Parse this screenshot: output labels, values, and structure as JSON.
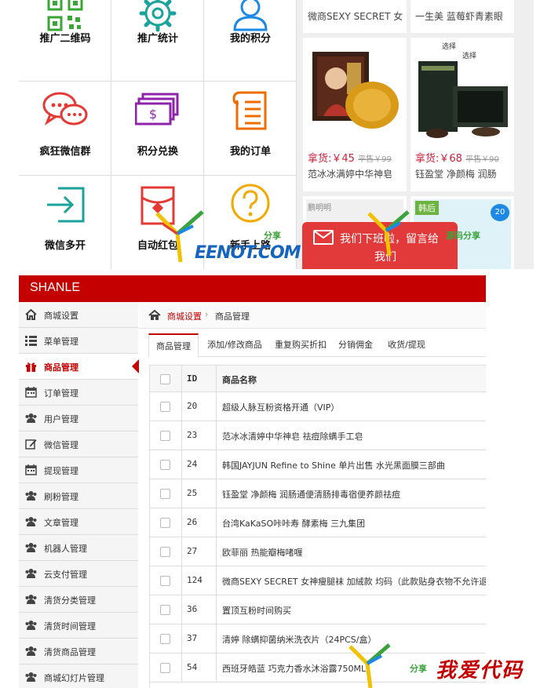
{
  "mobile": {
    "grid": [
      {
        "label": "推广二维码",
        "icon": "qrcode-icon"
      },
      {
        "label": "推广统计",
        "icon": "gear-icon"
      },
      {
        "label": "我的积分",
        "icon": "user-icon"
      },
      {
        "label": "疯狂微信群",
        "icon": "chat-bubbles-icon"
      },
      {
        "label": "积分兑换",
        "icon": "money-cards-icon"
      },
      {
        "label": "我的订单",
        "icon": "order-list-icon"
      },
      {
        "label": "微信多开",
        "icon": "enter-icon"
      },
      {
        "label": "自动红包",
        "icon": "red-envelope-icon"
      },
      {
        "label": "新手上路",
        "icon": "question-icon"
      }
    ],
    "products": [
      {
        "top_title": "微商SEXY SECRET 女"
      },
      {
        "top_title": "一生美 蓝莓虾青素眼"
      },
      {
        "price": "拿货:￥45",
        "orig": "平售￥99",
        "title": "范冰冰满婷中华神皂",
        "image": "soap-box-image"
      },
      {
        "price": "拿货:￥68",
        "orig": "平售￥90",
        "title": "钰盈堂 净颜梅 润肠",
        "image": "plum-box-image",
        "image_text_1": "选择",
        "image_text_2": "选择"
      },
      {
        "badge": "鹏明明",
        "image": "product-image"
      },
      {
        "badge": "韩后",
        "corner": "20",
        "image": "product-image"
      }
    ],
    "promo": {
      "line1": "我们下班啦，留言给",
      "line2": "我们"
    }
  },
  "watermarks": {
    "eenot": "EENOT.COM",
    "share1": "分享",
    "share2": "源码分享",
    "share3": "分享",
    "footer": "我爱代码"
  },
  "admin": {
    "brand": "SHANLE",
    "sidebar": [
      {
        "label": "商城设置",
        "icon": "home-icon"
      },
      {
        "label": "菜单管理",
        "icon": "list-icon"
      },
      {
        "label": "商品管理",
        "icon": "gift-icon",
        "active": true
      },
      {
        "label": "订单管理",
        "icon": "calendar-icon"
      },
      {
        "label": "用户管理",
        "icon": "users-icon"
      },
      {
        "label": "微信管理",
        "icon": "edit-icon"
      },
      {
        "label": "提现管理",
        "icon": "calendar-icon"
      },
      {
        "label": "刷粉管理",
        "icon": "users-icon"
      },
      {
        "label": "文章管理",
        "icon": "users-icon"
      },
      {
        "label": "机器人管理",
        "icon": "users-icon"
      },
      {
        "label": "云支付管理",
        "icon": "users-icon"
      },
      {
        "label": "清货分类管理",
        "icon": "users-icon"
      },
      {
        "label": "清货时间管理",
        "icon": "users-icon"
      },
      {
        "label": "清货商品管理",
        "icon": "users-icon"
      },
      {
        "label": "商城幻灯片管理",
        "icon": "users-icon"
      }
    ],
    "breadcrumb": {
      "parent": "商城设置",
      "separator": "›",
      "current": "商品管理"
    },
    "tabs": [
      "商品管理",
      "添加/修改商品",
      "重复购买折扣",
      "分销佣金",
      "收货/提现"
    ],
    "table": {
      "headers": {
        "id": "ID",
        "name": "商品名称"
      },
      "rows": [
        {
          "id": "20",
          "name": "超级人脉互粉资格开通（VIP）"
        },
        {
          "id": "23",
          "name": "范冰冰清婷中华神皂 祛痘除螨手工皂"
        },
        {
          "id": "24",
          "name": "韩国JAYJUN Refine to Shine 单片出售 水光黑面膜三部曲"
        },
        {
          "id": "25",
          "name": "钰盈堂 净颜梅 润肠通便清肠排毒宿便养颜祛痘"
        },
        {
          "id": "26",
          "name": "台湾KaKaSO咔咔寿 酵素梅 三九集团"
        },
        {
          "id": "27",
          "name": "欧菲丽 热能瓣梅啫喱"
        },
        {
          "id": "124",
          "name": "微商SEXY SECRET 女神瘦腿袜 加絨款 均码（此款贴身衣物不允许退）"
        },
        {
          "id": "36",
          "name": "置顶互粉时间购买"
        },
        {
          "id": "37",
          "name": "清婷 除螨抑菌纳米洗衣片（24PCS/盒）"
        },
        {
          "id": "54",
          "name": "西班牙皓蓝 巧克力香水沐浴露750ML"
        }
      ]
    }
  }
}
